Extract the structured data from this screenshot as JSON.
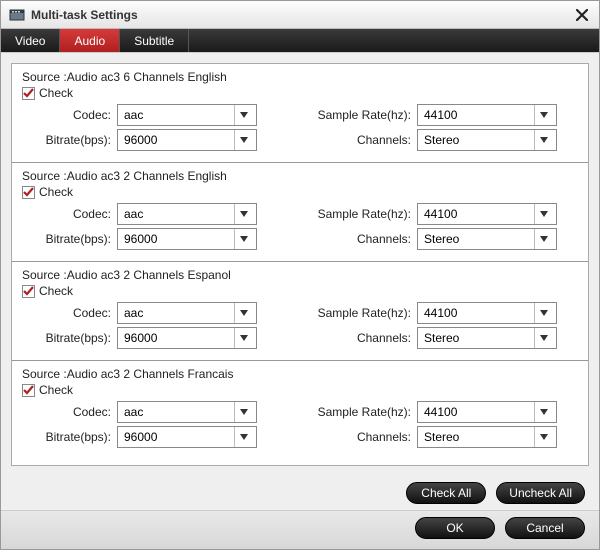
{
  "window": {
    "title": "Multi-task Settings"
  },
  "tabs": {
    "video": "Video",
    "audio": "Audio",
    "subtitle": "Subtitle",
    "active": "audio"
  },
  "labels": {
    "check": "Check",
    "codec": "Codec:",
    "bitrate": "Bitrate(bps):",
    "samplerate": "Sample Rate(hz):",
    "channels": "Channels:"
  },
  "tracks": [
    {
      "source": "Source :Audio  ac3  6 Channels  English",
      "checked": true,
      "codec": "aac",
      "bitrate": "96000",
      "samplerate": "44100",
      "channels": "Stereo"
    },
    {
      "source": "Source :Audio  ac3  2 Channels  English",
      "checked": true,
      "codec": "aac",
      "bitrate": "96000",
      "samplerate": "44100",
      "channels": "Stereo"
    },
    {
      "source": "Source :Audio  ac3  2 Channels  Espanol",
      "checked": true,
      "codec": "aac",
      "bitrate": "96000",
      "samplerate": "44100",
      "channels": "Stereo"
    },
    {
      "source": "Source :Audio  ac3  2 Channels  Francais",
      "checked": true,
      "codec": "aac",
      "bitrate": "96000",
      "samplerate": "44100",
      "channels": "Stereo"
    }
  ],
  "buttons": {
    "check_all": "Check All",
    "uncheck_all": "Uncheck All",
    "ok": "OK",
    "cancel": "Cancel"
  },
  "colors": {
    "accent": "#b02020"
  }
}
